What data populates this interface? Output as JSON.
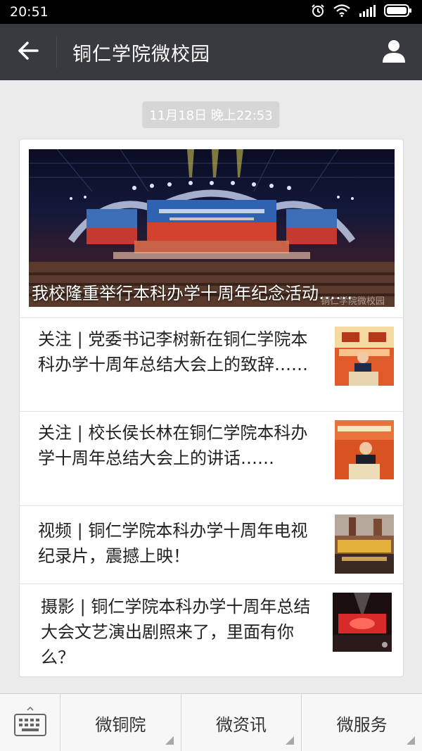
{
  "status_bar": {
    "time": "20:51",
    "icons": [
      "alarm-icon",
      "wifi-icon",
      "signal-icon",
      "battery-icon"
    ]
  },
  "header": {
    "title": "铜仁学院微校园",
    "back_icon": "arrow-left-icon",
    "profile_icon": "person-icon"
  },
  "timestamp": "11月18日 晚上22:53",
  "hero": {
    "title": "我校隆重举行本科办学十周年纪念活动……",
    "watermark": "铜仁学院微校园"
  },
  "articles": [
    {
      "text": "关注 |   党委书记李树新在铜仁学院本科办学十周年总结大会上的致辞……"
    },
    {
      "text": "关注 |   校长侯长林在铜仁学院本科办学十周年总结大会上的讲话……"
    },
    {
      "text": "视频 |   铜仁学院本科办学十周年电视纪录片，震撼上映！"
    },
    {
      "text": "摄影  |   铜仁学院本科办学十周年总结大会文艺演出剧照来了，里面有你么？"
    }
  ],
  "bottom_menu": {
    "keyboard_icon": "keyboard-icon",
    "items": [
      {
        "label": "微铜院"
      },
      {
        "label": "微资讯"
      },
      {
        "label": "微服务"
      }
    ]
  },
  "colors": {
    "title_bar": "#393a3f",
    "background": "#ebebeb",
    "status_bar": "#000000"
  }
}
